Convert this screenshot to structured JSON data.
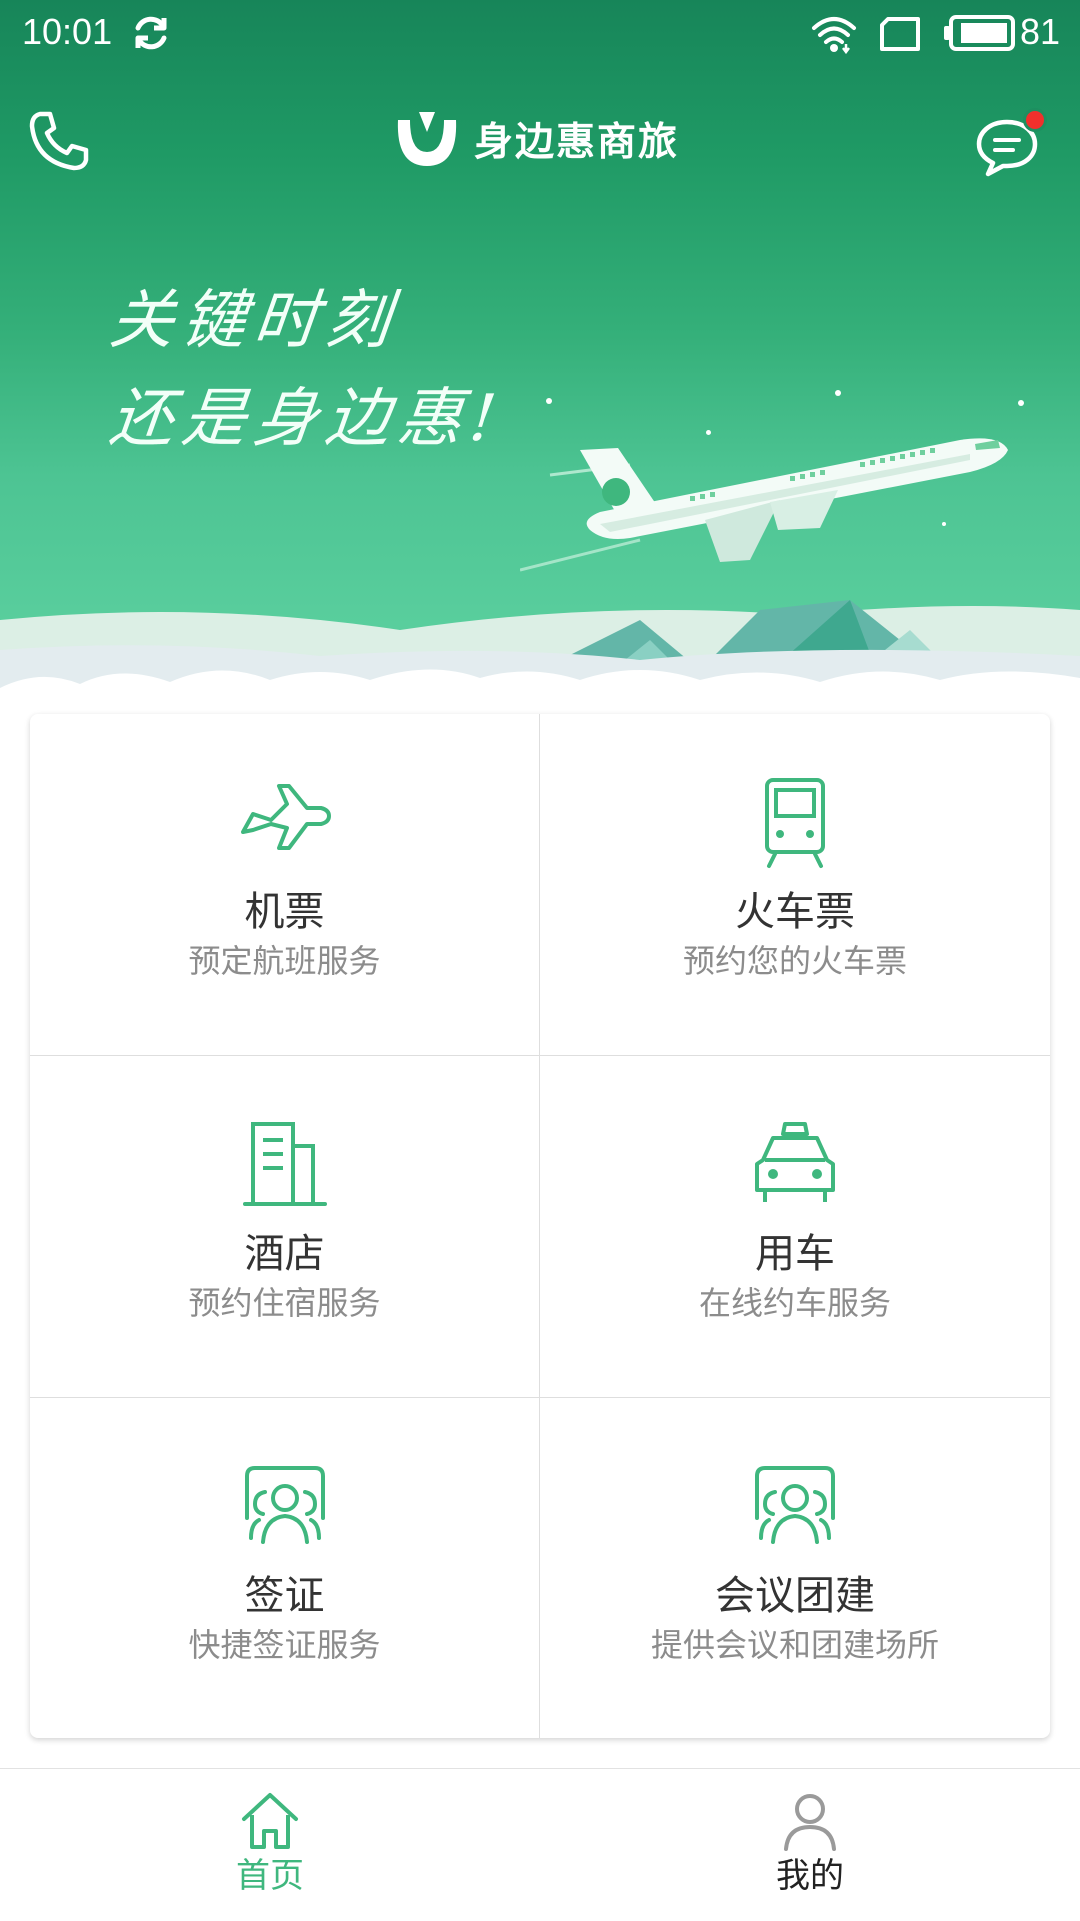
{
  "status_bar": {
    "time": "10:01",
    "battery": "81"
  },
  "header": {
    "brand_name": "身边惠商旅",
    "has_unread_message": true
  },
  "banner": {
    "slogan_line1": "关键时刻",
    "slogan_line2": "还是身边惠!"
  },
  "services": [
    {
      "title": "机票",
      "subtitle": "预定航班服务",
      "icon": "airplane-icon"
    },
    {
      "title": "火车票",
      "subtitle": "预约您的火车票",
      "icon": "train-icon"
    },
    {
      "title": "酒店",
      "subtitle": "预约住宿服务",
      "icon": "building-icon"
    },
    {
      "title": "用车",
      "subtitle": "在线约车服务",
      "icon": "taxi-icon"
    },
    {
      "title": "签证",
      "subtitle": "快捷签证服务",
      "icon": "people-icon"
    },
    {
      "title": "会议团建",
      "subtitle": "提供会议和团建场所",
      "icon": "people-icon"
    }
  ],
  "bottom_nav": {
    "items": [
      {
        "label": "首页",
        "icon": "home-icon",
        "active": true
      },
      {
        "label": "我的",
        "icon": "user-icon",
        "active": false
      }
    ]
  },
  "colors": {
    "brand_green": "#3fb77e",
    "header_green": "#178559",
    "notification_red": "#f0302c"
  }
}
